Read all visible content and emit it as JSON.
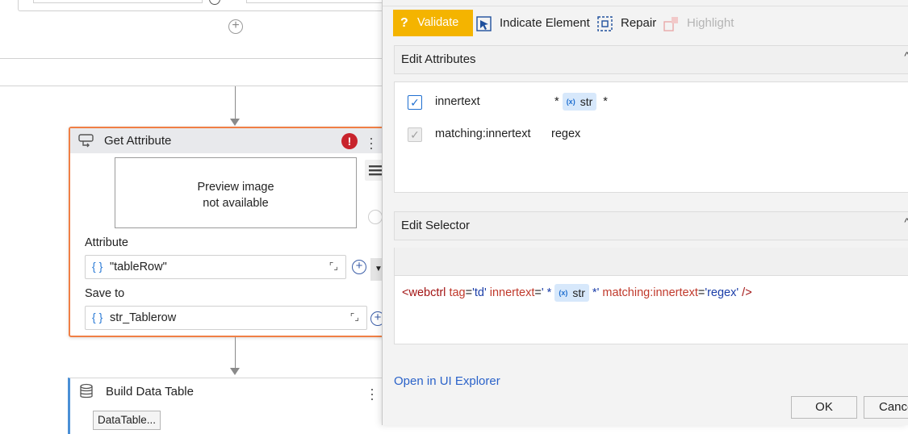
{
  "workflow": {
    "activities": [
      {
        "title": "Get Attribute",
        "preview_text_line1": "Preview image",
        "preview_text_line2": "not available",
        "attribute_label": "Attribute",
        "attribute_value": "\"tableRow\"",
        "save_to_label": "Save to",
        "save_to_value": "str_Tablerow",
        "has_error": true
      },
      {
        "title": "Build Data Table",
        "button_label": "DataTable..."
      }
    ]
  },
  "dialog": {
    "toolbar": {
      "validate": "Validate",
      "indicate_element": "Indicate Element",
      "repair": "Repair",
      "highlight": "Highlight"
    },
    "edit_attributes": {
      "title": "Edit Attributes",
      "rows": [
        {
          "name": "innertext",
          "checked": true,
          "prefix": "*",
          "variable": "str",
          "suffix": "*"
        },
        {
          "name": "matching:innertext",
          "checked": true,
          "value": "regex"
        }
      ]
    },
    "edit_selector": {
      "title": "Edit Selector",
      "selector": {
        "open": "<webctrl ",
        "tag_attr": "tag",
        "tag_val": "'td'",
        "inner_attr": "innertext",
        "inner_open": "' *",
        "variable": "str",
        "inner_close": "*'",
        "match_attr": "matching:innertext",
        "match_val": "'regex'",
        "close": " />"
      }
    },
    "open_in_ui_explorer": "Open in UI Explorer",
    "ok": "OK",
    "cancel": "Cance"
  },
  "colors": {
    "accent_validate": "#f4b400",
    "selected_activity_border": "#f07f45",
    "error": "#c8232c",
    "link": "#2a62c9"
  }
}
